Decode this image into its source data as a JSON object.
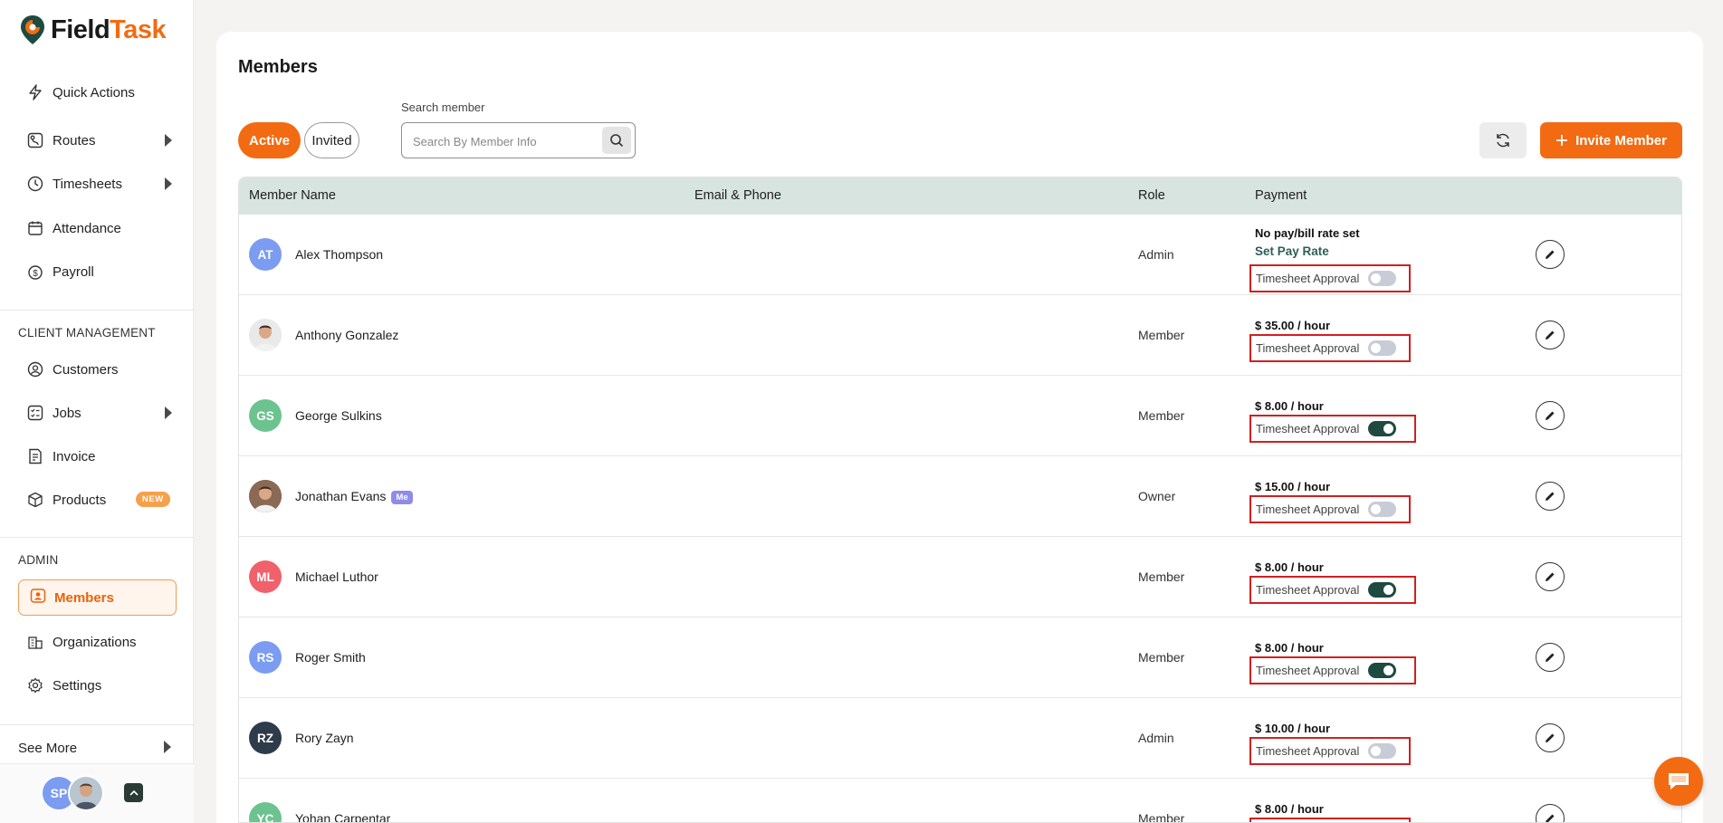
{
  "brand": {
    "name_part1": "Field",
    "name_part2": "Task",
    "accent": "#f26b12",
    "dark": "#1e4a40"
  },
  "sidebar": {
    "top_items": [
      {
        "label": "Quick Actions",
        "icon": "lightning-icon"
      },
      {
        "label": "Routes",
        "icon": "route-icon",
        "expandable": true
      },
      {
        "label": "Timesheets",
        "icon": "clock-icon",
        "expandable": true
      },
      {
        "label": "Attendance",
        "icon": "calendar-icon"
      },
      {
        "label": "Payroll",
        "icon": "dollar-circle-icon"
      }
    ],
    "client_section": "CLIENT MANAGEMENT",
    "client_items": [
      {
        "label": "Customers",
        "icon": "user-circle-icon"
      },
      {
        "label": "Jobs",
        "icon": "checklist-icon",
        "expandable": true
      },
      {
        "label": "Invoice",
        "icon": "invoice-icon"
      },
      {
        "label": "Products",
        "icon": "box-icon",
        "badge": "NEW"
      }
    ],
    "admin_section": "ADMIN",
    "admin_items": [
      {
        "label": "Members",
        "icon": "member-badge-icon",
        "active": true
      },
      {
        "label": "Organizations",
        "icon": "building-icon"
      },
      {
        "label": "Settings",
        "icon": "gear-icon"
      }
    ],
    "see_more": "See More",
    "user_initials": "SP"
  },
  "page": {
    "title": "Members",
    "tabs": {
      "active": "Active",
      "invited": "Invited"
    },
    "search": {
      "label": "Search member",
      "placeholder": "Search By Member Info",
      "value": ""
    },
    "invite_button": "Invite Member"
  },
  "table": {
    "headers": {
      "name": "Member Name",
      "contact": "Email & Phone",
      "role": "Role",
      "payment": "Payment"
    },
    "approval_label": "Timesheet Approval",
    "rows": [
      {
        "initials": "AT",
        "avatar_color": "#7c9cf1",
        "photo": false,
        "name": "Alex Thompson",
        "me": "",
        "role": "Admin",
        "pay": "No pay/bill rate set",
        "set_pay": "Set Pay Rate",
        "approval": false
      },
      {
        "initials": "",
        "avatar_color": "#e9e9e9",
        "photo": true,
        "name": "Anthony Gonzalez",
        "me": "",
        "role": "Member",
        "pay": "$ 35.00 / hour",
        "set_pay": "",
        "approval": false
      },
      {
        "initials": "GS",
        "avatar_color": "#6cc38f",
        "photo": false,
        "name": "George Sulkins",
        "me": "",
        "role": "Member",
        "pay": "$ 8.00 / hour",
        "set_pay": "",
        "approval": true
      },
      {
        "initials": "",
        "avatar_color": "#8a6a55",
        "photo": true,
        "name": "Jonathan Evans",
        "me": "Me",
        "role": "Owner",
        "pay": "$ 15.00 / hour",
        "set_pay": "",
        "approval": false
      },
      {
        "initials": "ML",
        "avatar_color": "#f1616b",
        "photo": false,
        "name": "Michael Luthor",
        "me": "",
        "role": "Member",
        "pay": "$ 8.00 / hour",
        "set_pay": "",
        "approval": true
      },
      {
        "initials": "RS",
        "avatar_color": "#7c9cf1",
        "photo": false,
        "name": "Roger Smith",
        "me": "",
        "role": "Member",
        "pay": "$ 8.00 / hour",
        "set_pay": "",
        "approval": true
      },
      {
        "initials": "RZ",
        "avatar_color": "#2d3b4a",
        "photo": false,
        "name": "Rory Zayn",
        "me": "",
        "role": "Admin",
        "pay": "$ 10.00 / hour",
        "set_pay": "",
        "approval": false
      },
      {
        "initials": "YC",
        "avatar_color": "#6cc38f",
        "photo": false,
        "name": "Yohan Carpentar",
        "me": "",
        "role": "Member",
        "pay": "$ 8.00 / hour",
        "set_pay": "",
        "approval": false
      }
    ]
  }
}
